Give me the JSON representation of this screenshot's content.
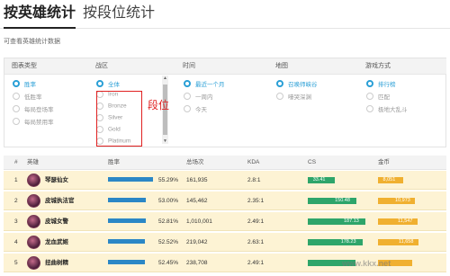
{
  "tabs": [
    {
      "label": "按英雄统计"
    },
    {
      "label": "按段位统计"
    }
  ],
  "description": "可查看英雄统计数据",
  "filters": {
    "chart_type": {
      "title": "图表类型",
      "options": [
        "胜率",
        "低胜率",
        "每局登场率",
        "每局禁用率"
      ],
      "selected": 0
    },
    "region": {
      "title": "战区",
      "options": [
        "全体",
        "Iron",
        "Bronze",
        "Silver",
        "Gold",
        "Platinum"
      ],
      "selected": 0
    },
    "time": {
      "title": "时间",
      "options": [
        "最近一个月",
        "一周内",
        "今天"
      ],
      "selected": 0
    },
    "map": {
      "title": "地图",
      "options": [
        "召唤师峡谷",
        "嚎哭深渊"
      ],
      "selected": 0
    },
    "mode": {
      "title": "游戏方式",
      "options": [
        "排行榜",
        "匹配",
        "极地大乱斗"
      ],
      "selected": 0
    }
  },
  "annotation": "段位",
  "table": {
    "headers": [
      "#",
      "英雄",
      "胜率",
      "总场次",
      "KDA",
      "CS",
      "金币"
    ],
    "rows": [
      {
        "rank": "1",
        "hero": "琴瑟仙女",
        "winrate": "55.29%",
        "winrate_pct": 55.29,
        "games": "161,935",
        "kda": "2.8:1",
        "cs": "33.41",
        "cs_fill": 0.45,
        "gold": "8,051",
        "gold_fill": 0.55
      },
      {
        "rank": "2",
        "hero": "皮城执法官",
        "winrate": "53.00%",
        "winrate_pct": 53.0,
        "games": "145,462",
        "kda": "2.35:1",
        "cs": "150.48",
        "cs_fill": 0.82,
        "gold": "10,973",
        "gold_fill": 0.82
      },
      {
        "rank": "3",
        "hero": "皮城女警",
        "winrate": "52.81%",
        "winrate_pct": 52.81,
        "games": "1,010,001",
        "kda": "2.49:1",
        "cs": "187.13",
        "cs_fill": 0.97,
        "gold": "11,547",
        "gold_fill": 0.88
      },
      {
        "rank": "4",
        "hero": "龙血武姬",
        "winrate": "52.52%",
        "winrate_pct": 52.52,
        "games": "219,042",
        "kda": "2.63:1",
        "cs": "178.23",
        "cs_fill": 0.92,
        "gold": "11,658",
        "gold_fill": 0.9
      },
      {
        "rank": "5",
        "hero": "扭曲树精",
        "winrate": "52.45%",
        "winrate_pct": 52.45,
        "games": "238,708",
        "kda": "2.49:1",
        "cs": "",
        "cs_fill": 0.8,
        "gold": "",
        "gold_fill": 0.75
      }
    ]
  },
  "watermark": "www.kkx.net",
  "colors": {
    "accent": "#2a9fd6",
    "winrate_bar": "#2b87c6",
    "cs_bar": "#2ea56a",
    "gold_bar": "#f0b030",
    "row_bg": "#fdf3d4",
    "annotation": "#e02020"
  }
}
